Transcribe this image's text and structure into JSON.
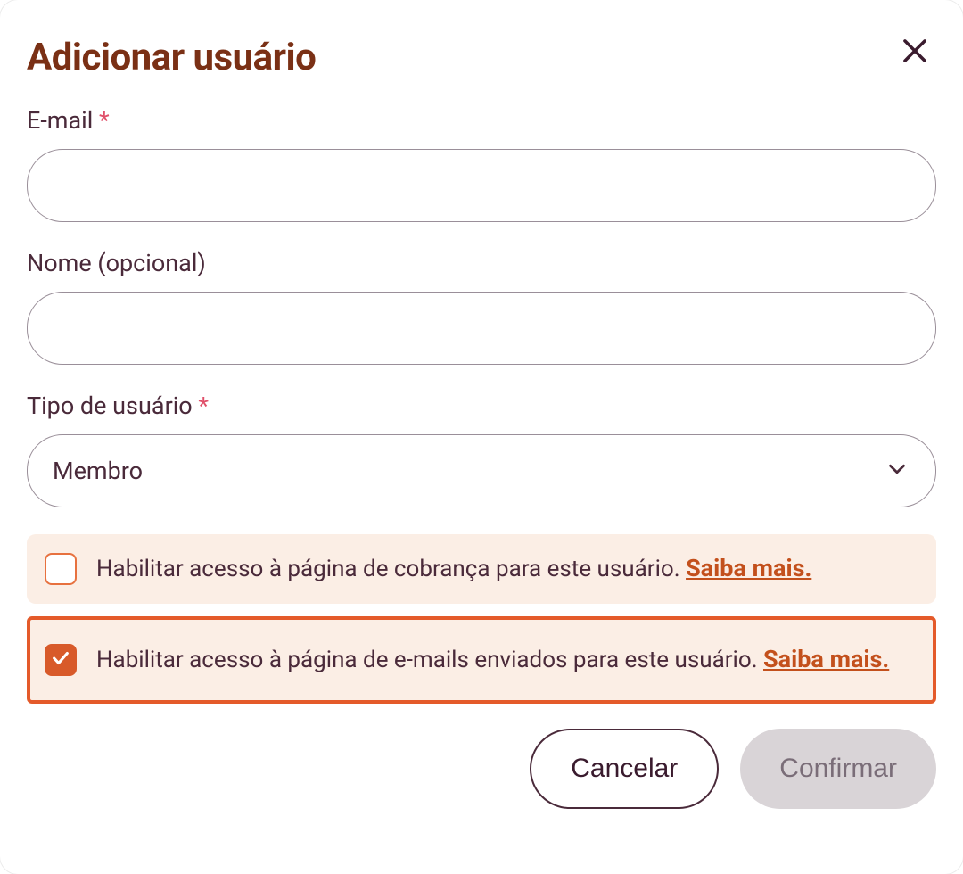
{
  "dialog": {
    "title": "Adicionar usuário",
    "email": {
      "label": "E-mail",
      "value": ""
    },
    "name": {
      "label": "Nome (opcional)",
      "value": ""
    },
    "userType": {
      "label": "Tipo de usuário",
      "value": "Membro"
    },
    "billingAccess": {
      "text": "Habilitar acesso à página de cobrança para este usuário.",
      "learnMore": "Saiba mais.",
      "checked": false
    },
    "emailAccess": {
      "text": "Habilitar acesso à página de e-mails enviados para este usuário.",
      "learnMore": "Saiba mais.",
      "checked": true
    },
    "buttons": {
      "cancel": "Cancelar",
      "confirm": "Confirmar"
    }
  }
}
